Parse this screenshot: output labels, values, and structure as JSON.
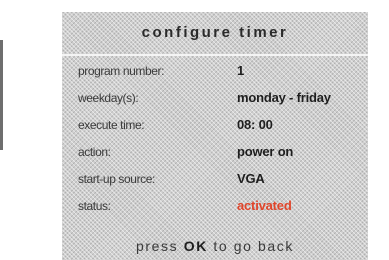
{
  "title": "configure timer",
  "rows": [
    {
      "label": "program number:",
      "value": "1"
    },
    {
      "label": "weekday(s):",
      "value": "monday - friday"
    },
    {
      "label": "execute time:",
      "value": "08: 00"
    },
    {
      "label": "action:",
      "value": "power on"
    },
    {
      "label": "start-up source:",
      "value": "VGA"
    },
    {
      "label": "status:",
      "value": "activated"
    }
  ],
  "footer": {
    "prefix": "press ",
    "key": "OK",
    "suffix": " to go back"
  },
  "colors": {
    "panel_background": "#cfcfcf",
    "status_activated": "#e0452b",
    "text": "#1e1e1e"
  }
}
